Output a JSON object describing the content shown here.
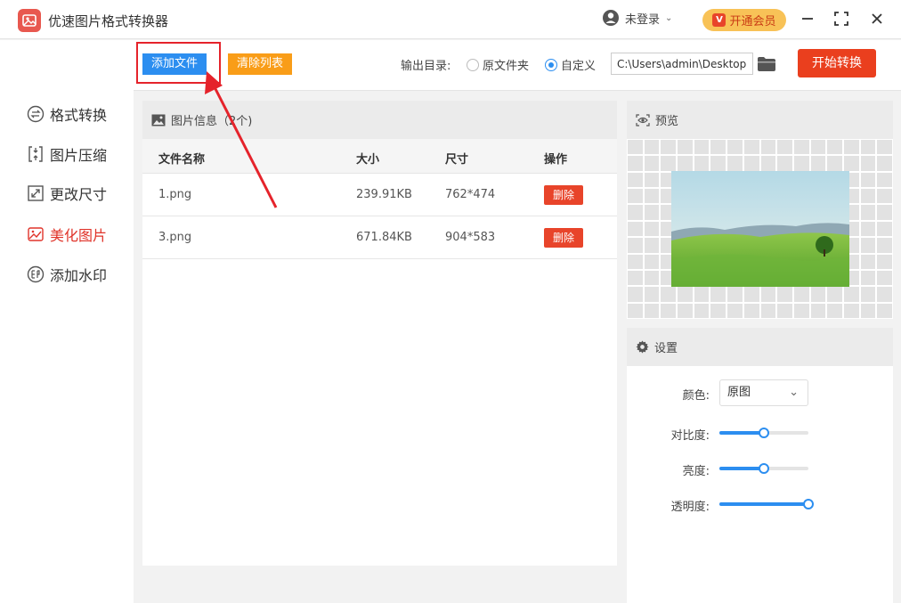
{
  "app": {
    "title": "优速图片格式转换器"
  },
  "user": {
    "login_label": "未登录"
  },
  "vip": {
    "label": "开通会员",
    "icon_letter": "V"
  },
  "sidebar": {
    "items": [
      {
        "label": "格式转换",
        "icon": "format-convert-icon"
      },
      {
        "label": "图片压缩",
        "icon": "compress-icon"
      },
      {
        "label": "更改尺寸",
        "icon": "resize-icon"
      },
      {
        "label": "美化图片",
        "icon": "beautify-icon",
        "active": true
      },
      {
        "label": "添加水印",
        "icon": "watermark-icon"
      }
    ]
  },
  "toolbar": {
    "add_label": "添加文件",
    "clear_label": "清除列表",
    "output_label": "输出目录:",
    "radio_original": "原文件夹",
    "radio_custom": "自定义",
    "path_value": "C:\\Users\\admin\\Desktop",
    "start_label": "开始转换"
  },
  "files": {
    "header": "图片信息（2个)",
    "columns": [
      "文件名称",
      "大小",
      "尺寸",
      "操作"
    ],
    "rows": [
      {
        "name": "1.png",
        "size": "239.91KB",
        "dims": "762*474",
        "action": "删除"
      },
      {
        "name": "3.png",
        "size": "671.84KB",
        "dims": "904*583",
        "action": "删除"
      }
    ]
  },
  "preview": {
    "header": "预览"
  },
  "settings": {
    "header": "设置",
    "color_label": "颜色:",
    "color_value": "原图",
    "contrast_label": "对比度:",
    "contrast_value": 0.5,
    "brightness_label": "亮度:",
    "brightness_value": 0.5,
    "opacity_label": "透明度:",
    "opacity_value": 1.0
  },
  "colors": {
    "accent": "#2c8ef0",
    "danger": "#e8442a",
    "warning": "#f99d18",
    "active_nav": "#e0342a"
  }
}
